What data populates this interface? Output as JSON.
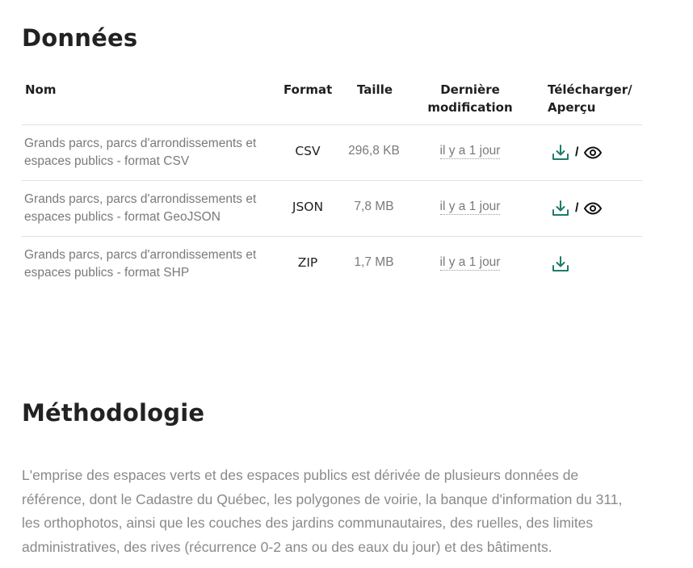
{
  "data_section": {
    "title": "Données",
    "columns": {
      "name": "Nom",
      "format": "Format",
      "size": "Taille",
      "modified": "Dernière modification",
      "download": "Télécharger/ Aperçu"
    },
    "rows": [
      {
        "name": "Grands parcs, parcs d'arrondissements et espaces publics - format CSV",
        "format": "CSV",
        "size": "296,8 KB",
        "modified": "il y a 1 jour",
        "separator": "/",
        "has_preview": true
      },
      {
        "name": "Grands parcs, parcs d'arrondissements et espaces publics - format GeoJSON",
        "format": "JSON",
        "size": "7,8 MB",
        "modified": "il y a 1 jour",
        "separator": "/",
        "has_preview": true
      },
      {
        "name": "Grands parcs, parcs d'arrondissements et espaces publics - format SHP",
        "format": "ZIP",
        "size": "1,7 MB",
        "modified": "il y a 1 jour",
        "has_preview": false
      }
    ]
  },
  "methodology_section": {
    "title": "Méthodologie",
    "text": "L'emprise des espaces verts et des espaces publics est dérivée de plusieurs données de référence, dont le Cadastre du Québec, les polygones de voirie, la banque d'information du 311, les orthophotos, ainsi que les couches des jardins communautaires, des ruelles, des limites administratives, des rives (récurrence 0-2 ans ou des eaux du jour) et des bâtiments."
  },
  "icons": {
    "download": "download-icon",
    "preview": "eye-icon"
  },
  "colors": {
    "download_icon": "#1f7a6a",
    "heading": "#222222",
    "muted_text": "#7a7a7a"
  }
}
